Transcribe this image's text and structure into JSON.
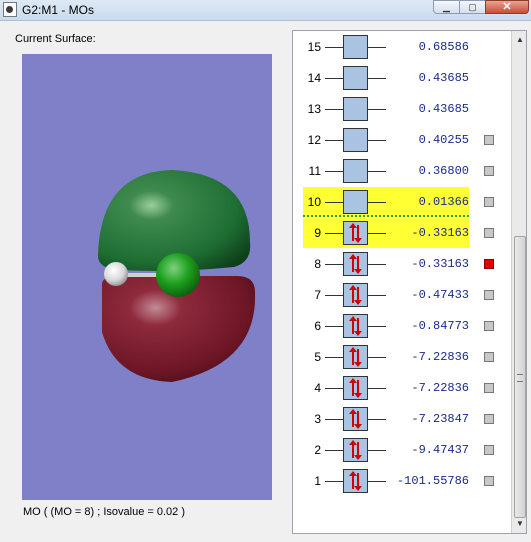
{
  "window": {
    "title": "G2:M1 - MOs"
  },
  "window_buttons": {
    "minimize": "▁",
    "maximize": "▢",
    "close": "✕"
  },
  "left_panel": {
    "label": "Current Surface:",
    "status": "MO ( (MO = 8) ; Isovalue = 0.02 )"
  },
  "orbitals": [
    {
      "num": "15",
      "energy": "0.68586",
      "occupied": false,
      "highlighted": false,
      "has_checkbox": false,
      "checked": false
    },
    {
      "num": "14",
      "energy": "0.43685",
      "occupied": false,
      "highlighted": false,
      "has_checkbox": false,
      "checked": false
    },
    {
      "num": "13",
      "energy": "0.43685",
      "occupied": false,
      "highlighted": false,
      "has_checkbox": false,
      "checked": false
    },
    {
      "num": "12",
      "energy": "0.40255",
      "occupied": false,
      "highlighted": false,
      "has_checkbox": true,
      "checked": false
    },
    {
      "num": "11",
      "energy": "0.36800",
      "occupied": false,
      "highlighted": false,
      "has_checkbox": true,
      "checked": false
    },
    {
      "num": "10",
      "energy": "0.01366",
      "occupied": false,
      "highlighted": true,
      "has_checkbox": true,
      "checked": false
    },
    {
      "num": "9",
      "energy": "-0.33163",
      "occupied": true,
      "highlighted": true,
      "has_checkbox": true,
      "checked": false
    },
    {
      "num": "8",
      "energy": "-0.33163",
      "occupied": true,
      "highlighted": false,
      "has_checkbox": true,
      "checked": true
    },
    {
      "num": "7",
      "energy": "-0.47433",
      "occupied": true,
      "highlighted": false,
      "has_checkbox": true,
      "checked": false
    },
    {
      "num": "6",
      "energy": "-0.84773",
      "occupied": true,
      "highlighted": false,
      "has_checkbox": true,
      "checked": false
    },
    {
      "num": "5",
      "energy": "-7.22836",
      "occupied": true,
      "highlighted": false,
      "has_checkbox": true,
      "checked": false
    },
    {
      "num": "4",
      "energy": "-7.22836",
      "occupied": true,
      "highlighted": false,
      "has_checkbox": true,
      "checked": false
    },
    {
      "num": "3",
      "energy": "-7.23847",
      "occupied": true,
      "highlighted": false,
      "has_checkbox": true,
      "checked": false
    },
    {
      "num": "2",
      "energy": "-9.47437",
      "occupied": true,
      "highlighted": false,
      "has_checkbox": true,
      "checked": false
    },
    {
      "num": "1",
      "energy": "-101.55786",
      "occupied": true,
      "highlighted": false,
      "has_checkbox": true,
      "checked": false
    }
  ],
  "colors": {
    "viewport_bg": "#8080c8",
    "positive_lobe": "#1e6e33",
    "negative_lobe": "#7a1a2a",
    "highlight": "#ffff33",
    "electron_arrow": "#d00000",
    "energy_text": "#1a2a8a"
  },
  "icons": {
    "scroll_up": "▲",
    "scroll_down": "▼"
  }
}
